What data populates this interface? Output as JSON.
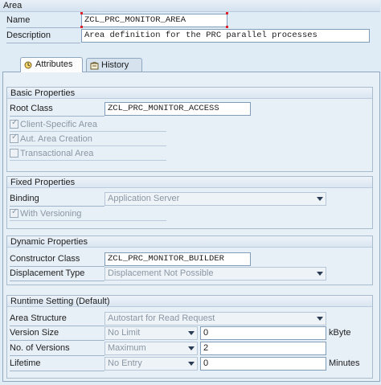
{
  "area": {
    "header": "Area",
    "name_label": "Name",
    "name_value": "ZCL_PRC_MONITOR_AREA",
    "description_label": "Description",
    "description_value": "Area definition for the PRC parallel processes"
  },
  "tabs": [
    {
      "label": "Attributes",
      "active": true,
      "icon": "attributes-icon"
    },
    {
      "label": "History",
      "active": false,
      "icon": "history-icon"
    }
  ],
  "basic": {
    "title": "Basic Properties",
    "root_class_label": "Root Class",
    "root_class_value": "ZCL_PRC_MONITOR_ACCESS",
    "client_specific_label": "Client-Specific Area",
    "client_specific_checked": true,
    "aut_creation_label": "Aut. Area Creation",
    "aut_creation_checked": true,
    "transactional_label": "Transactional Area",
    "transactional_checked": false
  },
  "fixed": {
    "title": "Fixed Properties",
    "binding_label": "Binding",
    "binding_value": "Application Server",
    "versioning_label": "With Versioning",
    "versioning_checked": true
  },
  "dynamic": {
    "title": "Dynamic Properties",
    "constructor_label": "Constructor Class",
    "constructor_value": "ZCL_PRC_MONITOR_BUILDER",
    "displacement_label": "Displacement Type",
    "displacement_value": "Displacement Not Possible"
  },
  "runtime": {
    "title": "Runtime Setting (Default)",
    "area_structure_label": "Area Structure",
    "area_structure_value": "Autostart for Read Request",
    "version_size_label": "Version Size",
    "version_size_select": "No Limit",
    "version_size_value": "0",
    "version_size_unit": "kByte",
    "num_versions_label": "No. of Versions",
    "num_versions_select": "Maximum",
    "num_versions_value": "2",
    "lifetime_label": "Lifetime",
    "lifetime_select": "No Entry",
    "lifetime_value": "0",
    "lifetime_unit": "Minutes"
  },
  "colors": {
    "background": "#dfebf5",
    "required_marker": "#e0202a",
    "disabled_text": "#8a96a3"
  }
}
